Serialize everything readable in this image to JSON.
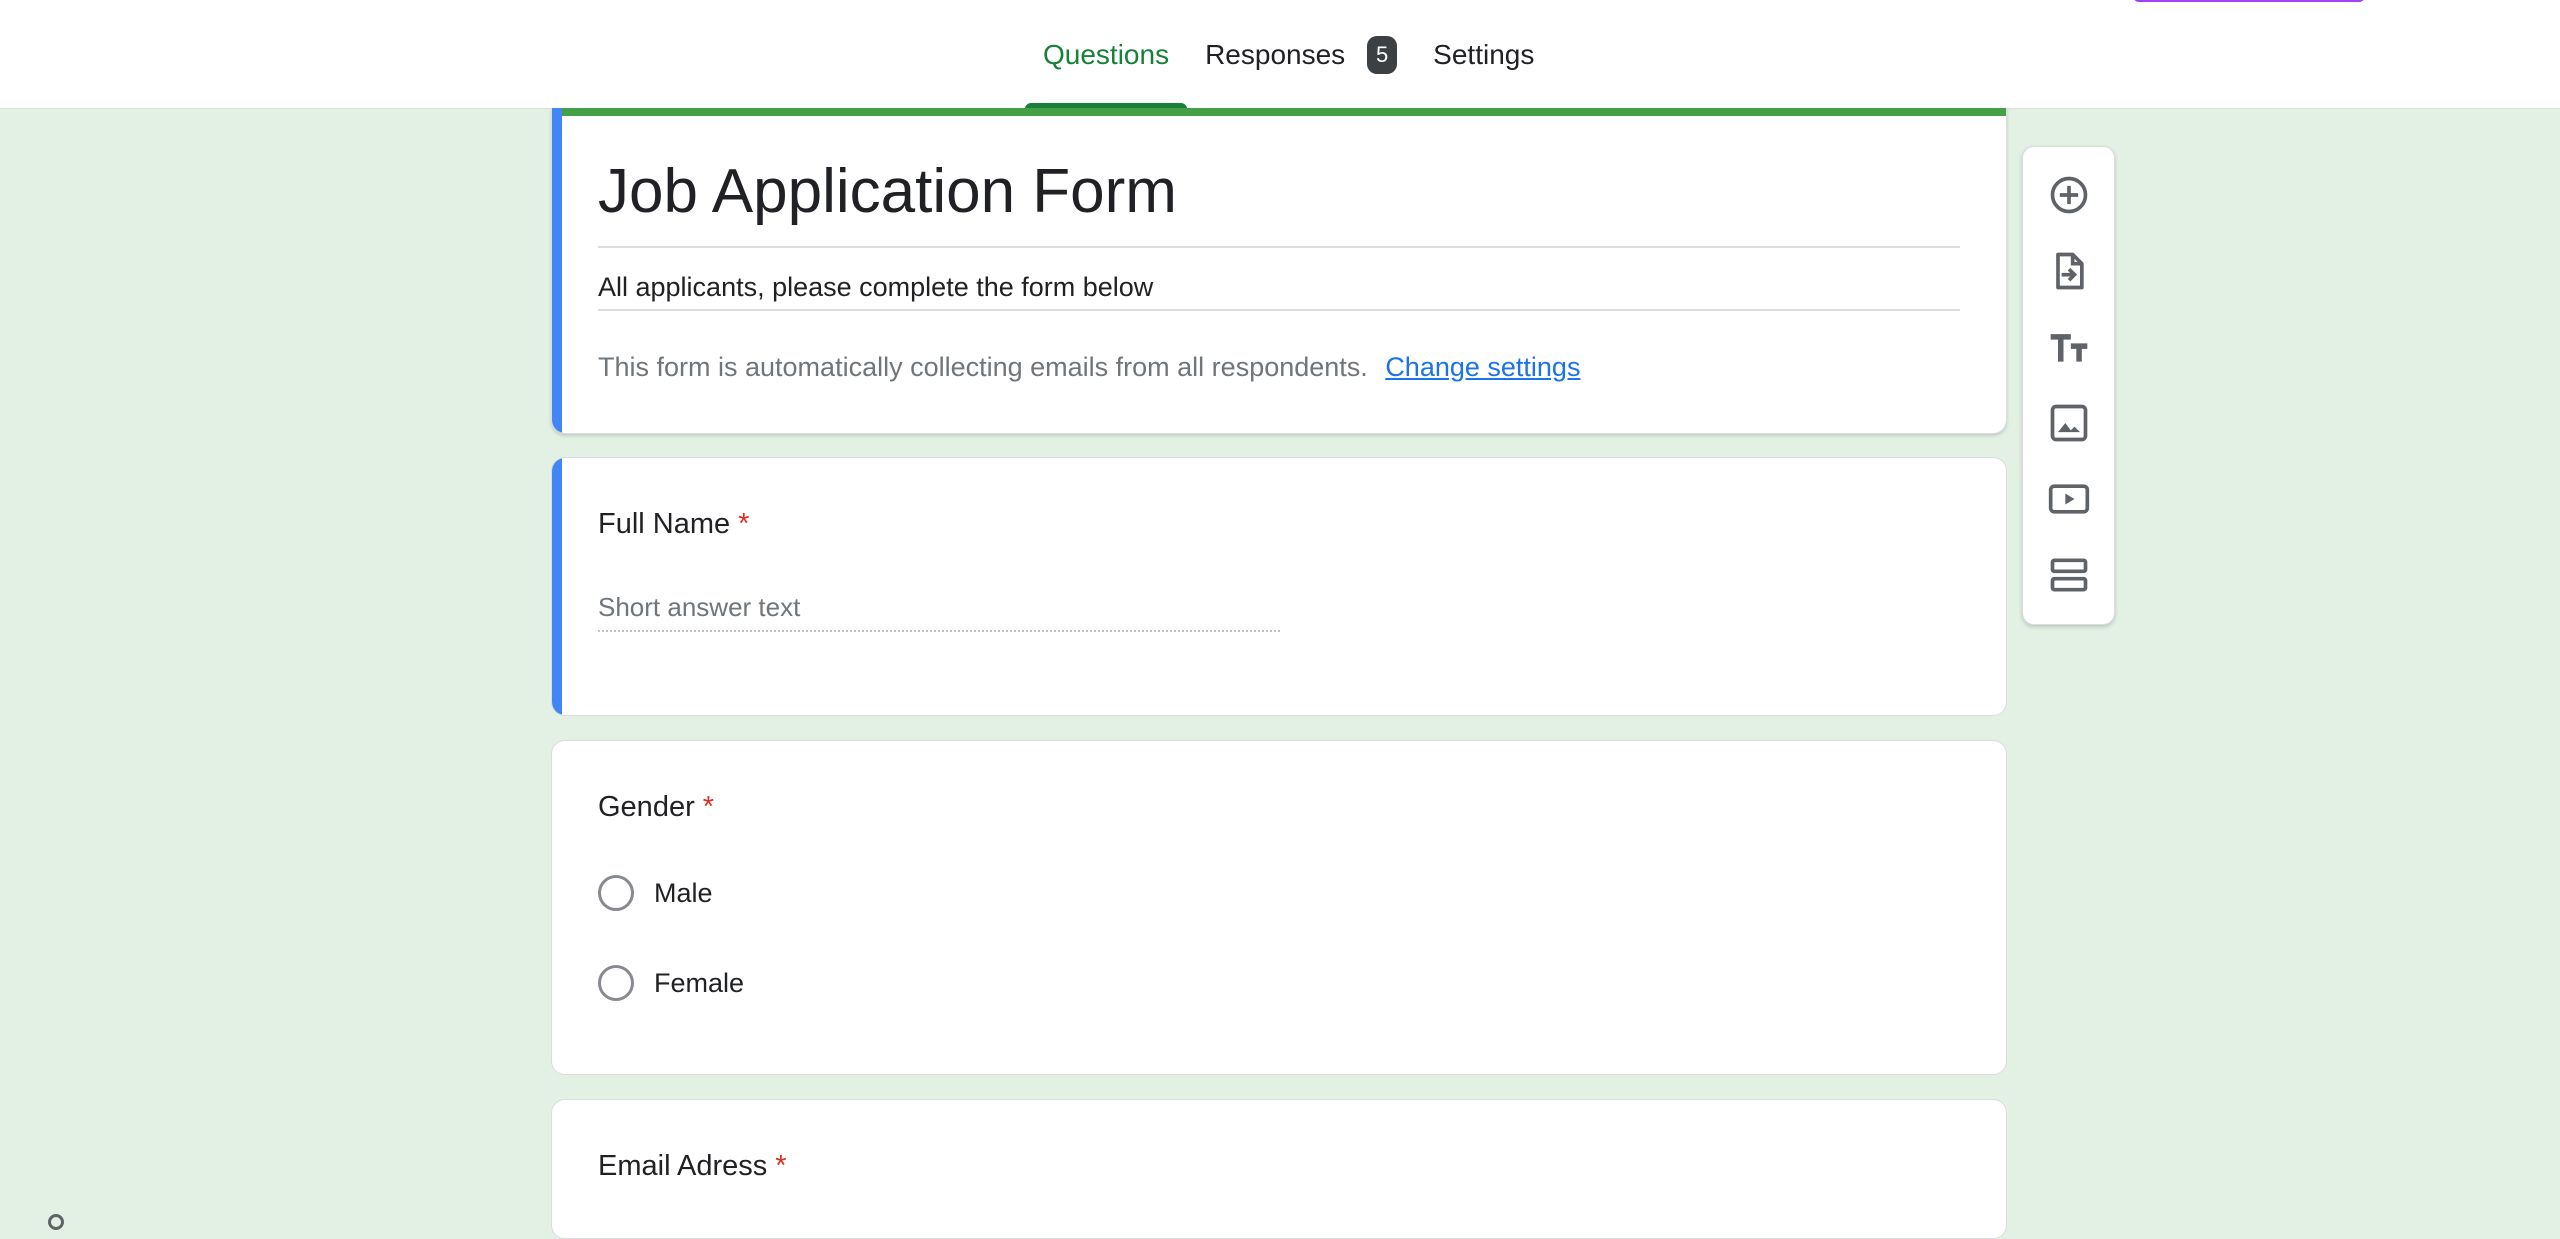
{
  "tabs": [
    {
      "label": "Questions",
      "active": true
    },
    {
      "label": "Responses",
      "badge": "5"
    },
    {
      "label": "Settings"
    }
  ],
  "form": {
    "title": "Job Application Form",
    "description": "All applicants, please complete the form below",
    "email_note": "This form is automatically collecting emails from all respondents.",
    "change_settings_link": "Change settings"
  },
  "questions": [
    {
      "title": "Full Name",
      "required_mark": "*",
      "answer_placeholder": "Short answer text"
    },
    {
      "title": "Gender",
      "required_mark": "*",
      "options": [
        "Male",
        "Female"
      ]
    },
    {
      "title": "Email Adress",
      "required_mark": "*"
    }
  ],
  "toolbar": {
    "icons": [
      "add-question-icon",
      "import-questions-icon",
      "add-title-icon",
      "add-image-icon",
      "add-video-icon",
      "add-section-icon"
    ]
  },
  "colors": {
    "background": "#e3f1e4",
    "accent_green": "#188038",
    "header_bar": "#43a047",
    "left_bar": "#4285f4",
    "required": "#d93025",
    "link": "#1a73e8"
  }
}
